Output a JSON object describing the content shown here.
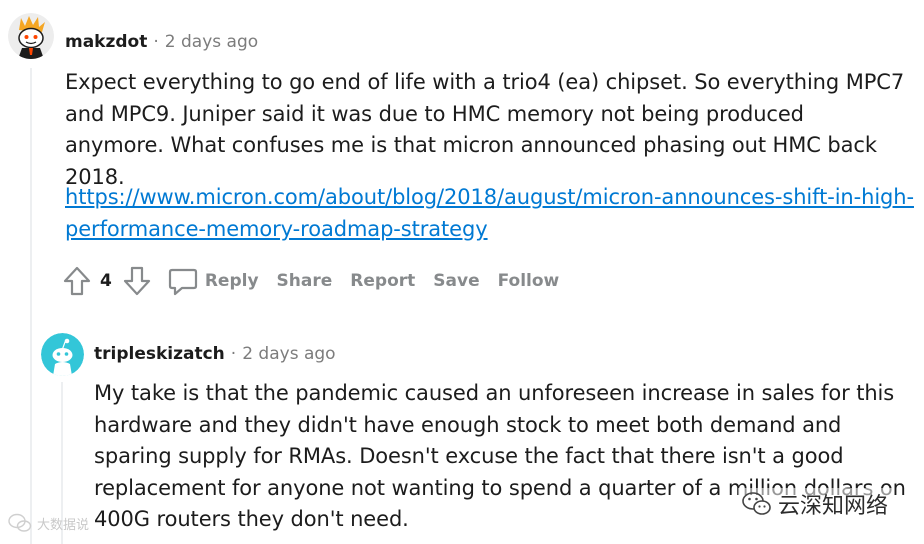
{
  "comments": [
    {
      "username": "makzdot",
      "separator": "·",
      "timestamp": "2 days ago",
      "body": "Expect everything to go end of life with a trio4 (ea) chipset. So everything MPC7 and MPC9. Juniper said it was due to HMC memory not being produced anymore. What confuses me is that micron announced phasing out HMC back 2018.",
      "link": "https://www.micron.com/about/blog/2018/august/micron-announces-shift-in-high-performance-memory-roadmap-strategy",
      "link_display_line1": "https://www.micron.com/about/blog/2018/august/micron-announces-shift-in-high-",
      "link_display_line2": "performance-memory-roadmap-strategy",
      "vote_count": "4",
      "actions": {
        "reply": "Reply",
        "share": "Share",
        "report": "Report",
        "save": "Save",
        "follow": "Follow"
      },
      "avatar_icon": "snoo-avatar-orange-hair"
    },
    {
      "username": "tripleskizatch",
      "separator": "·",
      "timestamp": "2 days ago",
      "body": "My take is that the pandemic caused an unforeseen increase in sales for this hardware and they didn't have enough stock to meet both demand and sparing supply for RMAs. Doesn't excuse the fact that there isn't a good replacement for anyone not wanting to spend a quarter of a million dollars on 400G routers they don't need.",
      "avatar_icon": "snoo-avatar-teal"
    }
  ],
  "watermarks": {
    "left": "大数据说",
    "right": "云深知网络"
  },
  "colors": {
    "link": "#0079d3",
    "muted": "#7c7c7c",
    "action": "#878a8c",
    "thread_line": "#edeff1",
    "avatar_teal": "#33c6d8"
  }
}
